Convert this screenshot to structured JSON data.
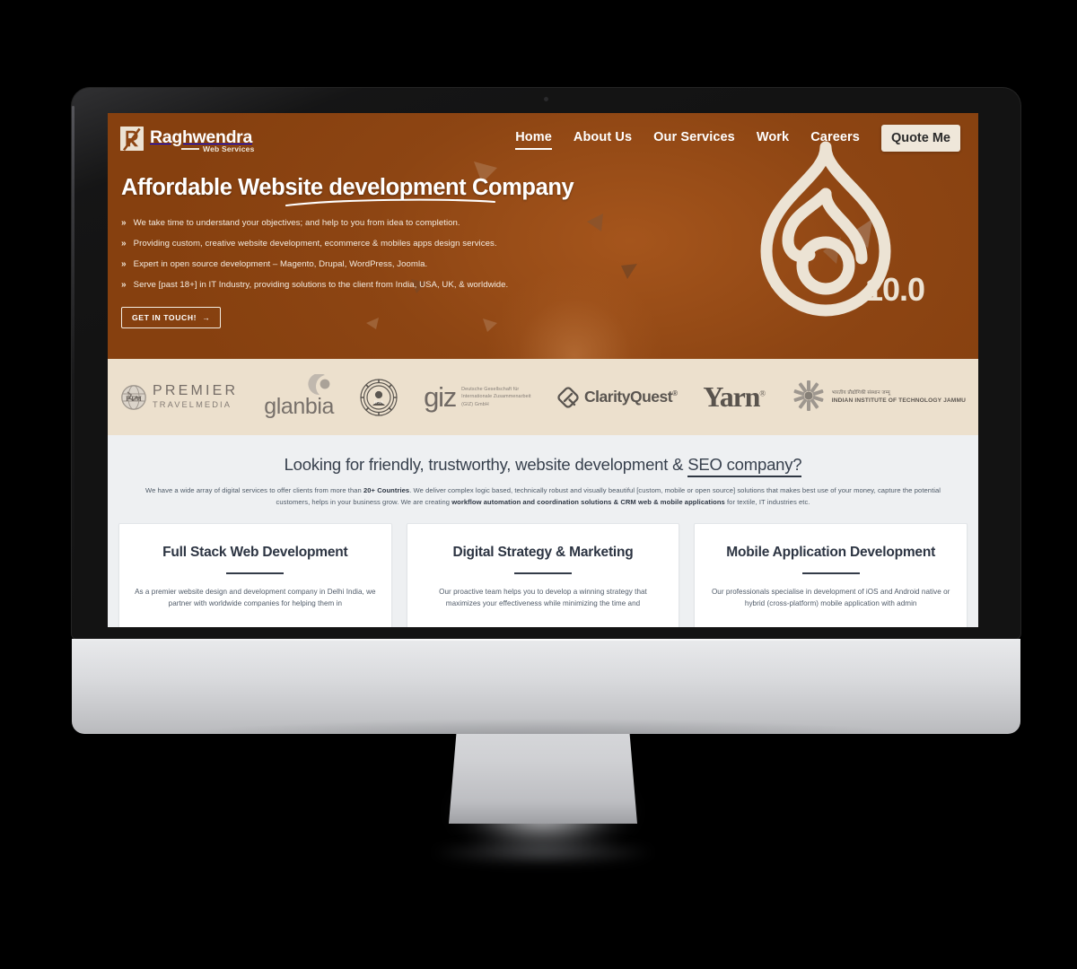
{
  "colors": {
    "hero_bg": "#8d4513",
    "client_strip_bg": "#ece0cd",
    "cream": "#ece3d4",
    "content_bg": "#eef0f2",
    "card_bg": "#ffffff",
    "heading_ink": "#37404d",
    "bezel": "#131313",
    "chin_silver": "#d9dadd"
  },
  "brand": {
    "name": "Raghwendra",
    "tagline": "Web Services",
    "logo_icon": "letter-r-logo-icon"
  },
  "nav": {
    "items": [
      {
        "label": "Home",
        "active": true
      },
      {
        "label": "About Us",
        "active": false
      },
      {
        "label": "Our Services",
        "active": false
      },
      {
        "label": "Work",
        "active": false
      },
      {
        "label": "Careers",
        "active": false
      }
    ],
    "cta_label": "Quote Me"
  },
  "hero": {
    "title": "Affordable Website development Company",
    "bullet_icon": "double-chevron-right-icon",
    "bullets": [
      "We take time to understand your objectives; and help to you from idea to completion.",
      "Providing custom, creative website development, ecommerce & mobiles apps design services.",
      "Expert in open source development – Magento, Drupal, WordPress, Joomla.",
      "Serve [past 18+] in IT Industry, providing solutions to the client from India, USA, UK, & worldwide."
    ],
    "cta_label": "GET IN TOUCH!",
    "cta_arrow": "→",
    "graphic": {
      "icon": "drupal-droplet-icon",
      "version_label": "10.0"
    }
  },
  "clients": [
    {
      "id": "premier-travel-media",
      "line1": "PREMIER",
      "line2": "TRAVELMEDIA",
      "icon": "globe-icon"
    },
    {
      "id": "glanbia",
      "line1": "glanbia",
      "line2": "",
      "icon": "crescent-icon"
    },
    {
      "id": "ipsa-seal",
      "line1": "",
      "line2": "",
      "icon": "government-seal-icon"
    },
    {
      "id": "giz",
      "line1": "giz",
      "line2": "Deutsche Gesellschaft für Internationale Zusammenarbeit (GIZ) GmbH",
      "icon": ""
    },
    {
      "id": "clarityquest",
      "line1": "ClarityQuest",
      "line2": "",
      "icon": "clarityquest-diamond-icon"
    },
    {
      "id": "yarn",
      "line1": "Yarn",
      "line2": "®",
      "icon": ""
    },
    {
      "id": "iit-jammu",
      "line1": "भारतीय प्रौद्योगिकी संस्थान जम्मू",
      "line2": "INDIAN INSTITUTE OF TECHNOLOGY JAMMU",
      "icon": "iit-jammu-emblem-icon"
    }
  ],
  "section": {
    "heading_prefix": "Looking for friendly, trustworthy, website development & ",
    "heading_underlined": "SEO company?",
    "paragraph_parts": [
      {
        "text": "We have a wide array of digital services to offer clients from more than ",
        "bold": false
      },
      {
        "text": "20+ Countries",
        "bold": true
      },
      {
        "text": ". We deliver complex logic based, technically robust and visually beautiful [custom, mobile or open source] solutions that makes best use of your money, capture the potential customers, helps in your business grow. We are creating ",
        "bold": false
      },
      {
        "text": "workflow automation and coordination solutions & CRM web & mobile applications",
        "bold": true
      },
      {
        "text": " for textile, IT industries etc.",
        "bold": false
      }
    ]
  },
  "cards": [
    {
      "title": "Full Stack Web Development",
      "body": "As a premier website design and development company in Delhi India, we partner with worldwide companies for helping them in"
    },
    {
      "title": "Digital Strategy & Marketing",
      "body": "Our proactive team helps you to develop a winning strategy that maximizes your effectiveness while minimizing the time and"
    },
    {
      "title": "Mobile Application Development",
      "body": "Our professionals specialise in development of iOS and Android native or hybrid (cross-platform) mobile application with admin"
    }
  ]
}
